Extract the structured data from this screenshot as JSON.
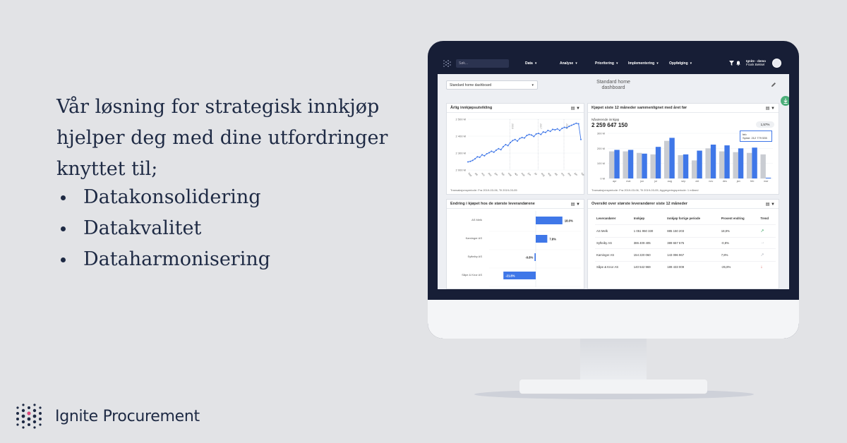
{
  "marketing": {
    "headline": "Vår løsning for strategisk innkjøp hjelper deg med dine utfordringer knyttet til;",
    "bullets": [
      "Datakonsolidering",
      "Datakvalitet",
      "Dataharmonisering"
    ]
  },
  "brand": {
    "name": "Ignite Procurement",
    "logo_icon": "dot-grid-logo-icon",
    "accent": "#3f77e8",
    "navy": "#171e36"
  },
  "app": {
    "search_placeholder": "Søk...",
    "nav": [
      {
        "label": "Data"
      },
      {
        "label": "Analyse"
      },
      {
        "label": "Prioritering"
      },
      {
        "label": "Implementering"
      },
      {
        "label": "Oppfølging"
      }
    ],
    "user": {
      "name": "Ignite - demo",
      "sub": "Frank Bekkel"
    },
    "dashboard_select": "Standard home dashboard",
    "dashboard_title": "Standard home dashboard"
  },
  "panels": {
    "annual": {
      "title": "Årlig innkjøpsutvikling",
      "footnote": "Transaksjonsperiode: Fra 2019-03-06, Til 2019-03-05",
      "chart_data": {
        "type": "line",
        "y_ticks": [
          "2 500 M",
          "2 400 M",
          "2 300 M",
          "2 000 M"
        ],
        "x_labels": [
          "Sep",
          "okt",
          "nov",
          "des",
          "jan",
          "feb",
          "mar",
          "apr",
          "mai",
          "jun",
          "jul",
          "aug",
          "sep",
          "okt",
          "nov",
          "des",
          "jan",
          "feb"
        ],
        "year_markers": [
          "2016",
          "2017",
          "2018"
        ],
        "values": [
          2080,
          2085,
          2095,
          2110,
          2130,
          2125,
          2150,
          2140,
          2160,
          2170,
          2185,
          2175,
          2195,
          2210,
          2200,
          2230,
          2250,
          2240,
          2270,
          2290,
          2300,
          2285,
          2310,
          2320,
          2315,
          2340,
          2350,
          2345,
          2330,
          2355,
          2360,
          2350,
          2375,
          2370,
          2390,
          2380,
          2400,
          2395,
          2405,
          2390,
          2410,
          2420,
          2415,
          2430,
          2440,
          2450,
          2460,
          2455,
          2300
        ]
      }
    },
    "monthly": {
      "title": "Kjøpet siste 12 måneder sammenlignet med året før",
      "kpi_label": "Nåværende innkjøp",
      "kpi_value": "2 259 647 150",
      "kpi_change": "1,57%",
      "tooltip_title": "feb",
      "tooltip_value": "Spine: 212 779 535",
      "footnote": "Transaksjonsperiode: Fra 2019-03-06, Til 2019-03-05, Aggregeringsperiode: 1 måned",
      "chart_data": {
        "type": "bar",
        "categories": [
          "apr",
          "mai",
          "jun",
          "jul",
          "aug",
          "sep",
          "okt",
          "nov",
          "des",
          "jan",
          "feb",
          "mar"
        ],
        "y_ticks": [
          "300 M",
          "200 M",
          "100 M",
          "0 M"
        ],
        "series": [
          {
            "values": [
              180,
              180,
              170,
              160,
              250,
              155,
              120,
              200,
              180,
              175,
              170,
              160
            ]
          },
          {
            "values": [
              190,
              190,
              165,
              210,
              270,
              160,
              185,
              225,
              220,
              200,
              205,
              5
            ]
          }
        ]
      }
    },
    "change": {
      "title": "Endring i kjøpet hos de største leverandørene",
      "chart_data": {
        "type": "bar",
        "categories": [
          "AS Melk",
          "Kaminger AS",
          "Syfteiby AS",
          "Såpe & Knor AS"
        ],
        "values": [
          18.0,
          7.8,
          -0.8,
          -21.8
        ],
        "labels": [
          "18.0%",
          "7.8%",
          "-0.8%",
          "-21.8%"
        ]
      }
    },
    "overview": {
      "title": "Oversikt over største leverandører siste 12 måneder",
      "headers": [
        "Leverandører",
        "Innkjøp",
        "Innkjøp forrige periode",
        "Prosent endring",
        "Trend"
      ],
      "rows": [
        {
          "name": "AS Melk",
          "purchase": "1 051 950 330",
          "previous": "885 150 203",
          "change": "18,8%",
          "trend": "↗",
          "trend_color": "#2e9e5b"
        },
        {
          "name": "Syfteiby AS",
          "purchase": "386 409 405",
          "previous": "389 657 575",
          "change": "-0,8%",
          "trend": "→",
          "trend_color": "#b0b4bc"
        },
        {
          "name": "Kaminger AS",
          "purchase": "154 220 060",
          "previous": "143 096 967",
          "change": "7,8%",
          "trend": "↗",
          "trend_color": "#b0b4bc"
        },
        {
          "name": "Såpe & Knor AS",
          "purchase": "140 542 969",
          "previous": "189 433 009",
          "change": "-25,8%",
          "trend": "↓",
          "trend_color": "#d9443b"
        }
      ]
    }
  }
}
